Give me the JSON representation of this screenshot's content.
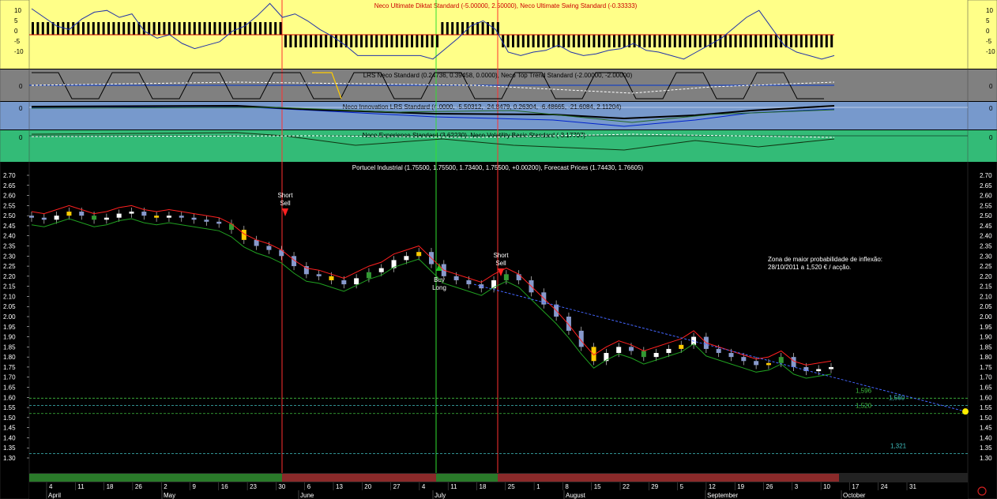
{
  "panels": {
    "p1": {
      "title": "Neco Ultimate Diktat Standard (-5.00000, 2.50000), Neco Ultimate Swing Standard (-0.33333)",
      "ticks": [
        "10",
        "5",
        "0",
        "-5",
        "-10"
      ],
      "bg": "#ffff88"
    },
    "p2": {
      "title": "LRS Neco Standard (0.24736, 0.39458, 0.0000), Neco Top Trend Standard (-2.00000, -2.00000)",
      "ticks": [
        "0"
      ],
      "bg": "#808080"
    },
    "p3": {
      "title": "Neco Innovation LRS Standard (4.0000, -5.50312, -24.8479, 0.26304, -6.48665, -21.6084, 2.11204)",
      "ticks": [
        "0"
      ],
      "bg": "#7799cc"
    },
    "p4": {
      "title": "Neco Experience Standard (3.62230), Neco Volatility Basic Standard (-3.17797)",
      "ticks": [
        "0"
      ],
      "bg": "#33bb77"
    }
  },
  "chart_data": {
    "type": "candlestick",
    "title": "Portucel Industrial (1.75500, 1.75500, 1.73400, 1.75500, +0.00200), Forecast Prices (1.74430, 1.76605)",
    "ylim": [
      1.25,
      2.75
    ],
    "yticks": [
      "2.70",
      "2.65",
      "2.60",
      "2.55",
      "2.50",
      "2.45",
      "2.40",
      "2.35",
      "2.30",
      "2.25",
      "2.20",
      "2.15",
      "2.10",
      "2.05",
      "2.00",
      "1.95",
      "1.90",
      "1.85",
      "1.80",
      "1.75",
      "1.70",
      "1.65",
      "1.60",
      "1.55",
      "1.50",
      "1.45",
      "1.40",
      "1.35",
      "1.30"
    ],
    "x_day_labels": [
      "4",
      "11",
      "18",
      "26",
      "2",
      "9",
      "16",
      "23",
      "30",
      "6",
      "13",
      "20",
      "27",
      "4",
      "11",
      "18",
      "25",
      "1",
      "8",
      "15",
      "22",
      "29",
      "5",
      "12",
      "19",
      "26",
      "3",
      "10",
      "17",
      "24",
      "31"
    ],
    "x_month_labels": [
      "April",
      "May",
      "June",
      "July",
      "August",
      "September",
      "October"
    ],
    "close_series": [
      2.49,
      2.48,
      2.5,
      2.52,
      2.5,
      2.48,
      2.49,
      2.51,
      2.52,
      2.5,
      2.49,
      2.5,
      2.49,
      2.48,
      2.47,
      2.46,
      2.43,
      2.38,
      2.35,
      2.33,
      2.3,
      2.25,
      2.21,
      2.2,
      2.18,
      2.16,
      2.19,
      2.22,
      2.24,
      2.28,
      2.3,
      2.32,
      2.26,
      2.2,
      2.18,
      2.16,
      2.14,
      2.18,
      2.21,
      2.18,
      2.12,
      2.06,
      2.0,
      1.93,
      1.85,
      1.78,
      1.82,
      1.85,
      1.83,
      1.8,
      1.82,
      1.84,
      1.86,
      1.9,
      1.84,
      1.82,
      1.8,
      1.78,
      1.76,
      1.77,
      1.8,
      1.75,
      1.73,
      1.74,
      1.75
    ],
    "signals": [
      {
        "label1": "Short",
        "label2": "Sell",
        "color": "#ff2020",
        "dir": "down",
        "x_day": "30 May"
      },
      {
        "label1": "Buy",
        "label2": "Long",
        "color": "#20c020",
        "dir": "up",
        "x_day": "4 July"
      },
      {
        "label1": "Short",
        "label2": "Sell",
        "color": "#ff2020",
        "dir": "down",
        "x_day": "18 July"
      }
    ],
    "levels": [
      {
        "value": 1.596,
        "label": "1,596",
        "color": "#40c040"
      },
      {
        "value": 1.56,
        "label": "1,560",
        "color": "#40c0c0"
      },
      {
        "value": 1.52,
        "label": "1,520",
        "color": "#40c040"
      },
      {
        "value": 1.321,
        "label": "1,321",
        "color": "#40c0c0"
      }
    ],
    "annotation": {
      "line1": "Zona de maior probabilidade de inflexão:",
      "line2": "28/10/2011 a 1,520 € / acção."
    },
    "forecast_end": 1.53,
    "grid": false
  }
}
